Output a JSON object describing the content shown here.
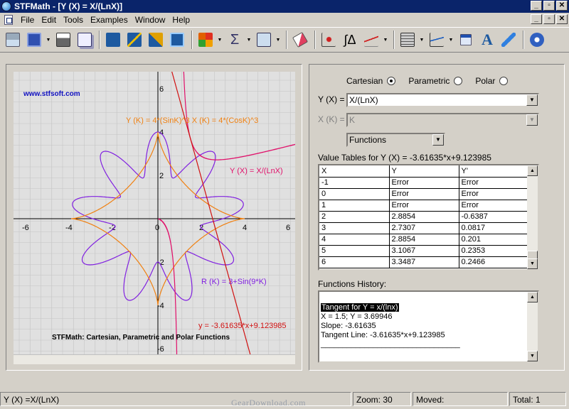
{
  "window": {
    "title": "STFMath - [Y (X) = X/(LnX)]",
    "controls": [
      "_",
      "▫",
      "✕"
    ]
  },
  "menu": {
    "items": [
      "File",
      "Edit",
      "Tools",
      "Examples",
      "Window",
      "Help"
    ],
    "mdi_controls": [
      "_",
      "▫",
      "✕"
    ]
  },
  "toolbar": {
    "icons": [
      "table-icon",
      "window-icon",
      "print-icon",
      "copy-icon",
      "import-icon",
      "zoom-out-icon",
      "zoom-in-icon",
      "zoom-fit-icon",
      "colors-icon",
      "sigma-icon",
      "view-icon",
      "eraser-icon",
      "point-icon",
      "integral-icon",
      "tangent-icon",
      "calculator-icon",
      "chart-icon",
      "window-list-icon",
      "text-icon",
      "pen-icon",
      "settings-icon"
    ]
  },
  "graph": {
    "watermark": "www.stfsoft.com",
    "x_ticks": [
      "-6",
      "-4",
      "-2",
      "0",
      "2",
      "4",
      "6"
    ],
    "y_ticks": [
      "6",
      "4",
      "2",
      "-2",
      "-4",
      "-6"
    ],
    "labels": {
      "parametric": "Y (K) = 4*(SinK)^3  X (K) = 4*(CosK)^3",
      "cartesian": "Y (X) = X/(LnX)",
      "polar": "R (K) = 3+Sin(9*K)",
      "tangent": "y = -3.61635*x+9.123985"
    },
    "caption": "STFMath: Cartesian, Parametric and Polar Functions",
    "colors": {
      "parametric": "#f08010",
      "cartesian": "#e0106a",
      "polar": "#8020e0",
      "tangent": "#d01010",
      "watermark": "#1010c0"
    }
  },
  "panel": {
    "mode": {
      "options": [
        "Cartesian",
        "Parametric",
        "Polar"
      ],
      "selected": "Cartesian"
    },
    "y_label": "Y (X) =",
    "y_value": "X/(LnX)",
    "x_label": "X (K) =",
    "x_value": "K",
    "type_value": "Functions",
    "table_title": "Value Tables for Y (X) = -3.61635*x+9.123985",
    "table_headers": [
      "X",
      "Y",
      "Y'"
    ],
    "table_rows": [
      [
        "-1",
        "Error",
        "Error"
      ],
      [
        "0",
        "Error",
        "Error"
      ],
      [
        "1",
        "Error",
        "Error"
      ],
      [
        "2",
        "2.8854",
        "-0.6387"
      ],
      [
        "3",
        "2.7307",
        "0.0817"
      ],
      [
        "4",
        "2.8854",
        "0.201"
      ],
      [
        "5",
        "3.1067",
        "0.2353"
      ],
      [
        "6",
        "3.3487",
        "0.2466"
      ]
    ],
    "history_title": "Functions History:",
    "history_lines": [
      "Tangent for Y = x/(lnx)",
      "X = 1.5; Y = 3.69946",
      "Slope: -3.61635",
      "Tangent Line: -3.61635*x+9.123985",
      "________________________________"
    ]
  },
  "status": {
    "function": "Y (X) =X/(LnX)",
    "zoom": "Zoom: 30",
    "moved": "Moved:",
    "total": "Total: 1"
  },
  "footer_watermark": "GearDownload.com"
}
